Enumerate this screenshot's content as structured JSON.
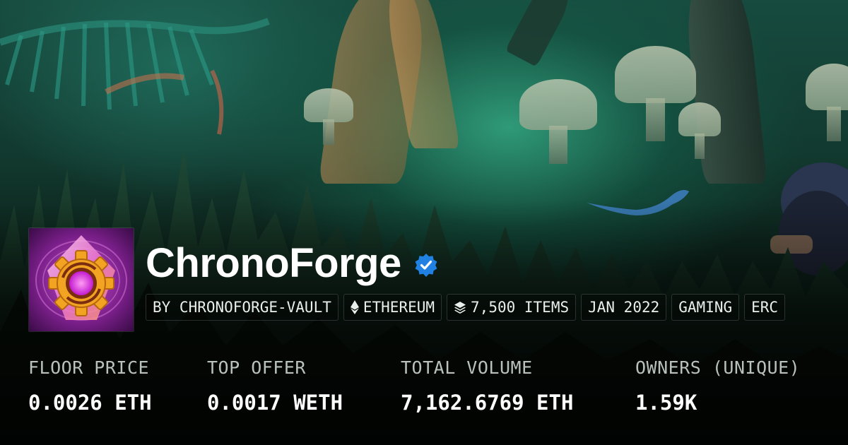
{
  "collection": {
    "name": "ChronoForge",
    "verified": true,
    "verified_icon": "verified-badge-icon",
    "accent_color": "#2081e2"
  },
  "tags": [
    {
      "label": "BY CHRONOFORGE-VAULT",
      "icon": null
    },
    {
      "label": "ETHEREUM",
      "icon": "ethereum-icon"
    },
    {
      "label": "7,500 ITEMS",
      "icon": "layers-icon"
    },
    {
      "label": "JAN 2022",
      "icon": null
    },
    {
      "label": "GAMING",
      "icon": null
    },
    {
      "label": "ERC",
      "icon": null
    }
  ],
  "stats": [
    {
      "label": "FLOOR PRICE",
      "value": "0.0026 ETH"
    },
    {
      "label": "TOP OFFER",
      "value": "0.0017 WETH"
    },
    {
      "label": "TOTAL VOLUME",
      "value": "7,162.6769 ETH"
    },
    {
      "label": "OWNERS (UNIQUE)",
      "value": "1.59K"
    }
  ]
}
